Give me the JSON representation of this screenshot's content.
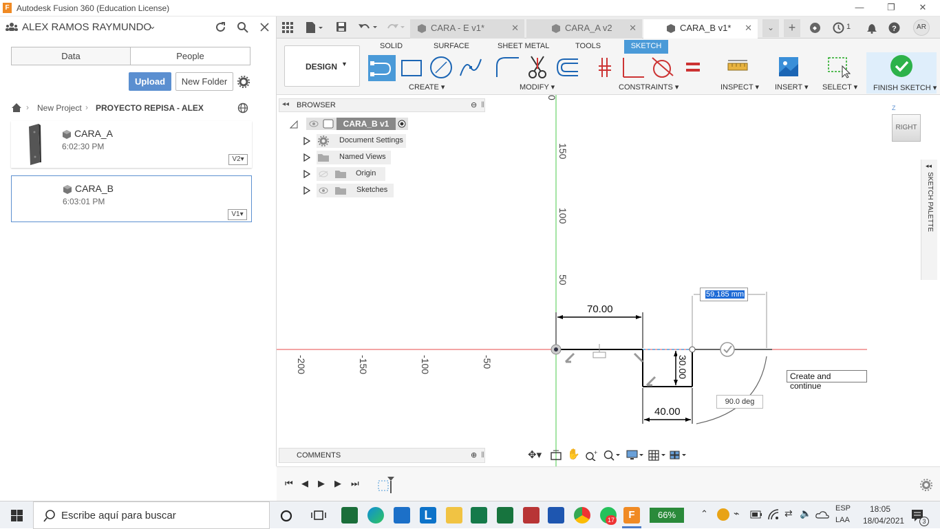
{
  "window": {
    "title": "Autodesk Fusion 360 (Education License)",
    "app_icon": "F"
  },
  "user": {
    "name": "ALEX RAMOS RAYMUNDO",
    "avatar": "AR"
  },
  "data_panel": {
    "tabs": [
      "Data",
      "People"
    ],
    "upload_label": "Upload",
    "new_folder_label": "New Folder",
    "breadcrumb": [
      "New Project",
      "PROYECTO REPISA - ALEX"
    ],
    "files": [
      {
        "name": "CARA_A",
        "time": "6:02:30 PM",
        "version": "V2"
      },
      {
        "name": "CARA_B",
        "time": "6:03:01 PM",
        "version": "V1"
      }
    ]
  },
  "doc_tabs": [
    {
      "label": "CARA - E v1*",
      "active": false
    },
    {
      "label": "CARA_A v2",
      "active": false
    },
    {
      "label": "CARA_B v1*",
      "active": true
    }
  ],
  "header_badges": {
    "jobs_count": "1"
  },
  "ribbon": {
    "workspace": "DESIGN",
    "tabs": [
      "SOLID",
      "SURFACE",
      "SHEET METAL",
      "TOOLS",
      "SKETCH"
    ],
    "active_tab": "SKETCH",
    "groups": [
      "CREATE",
      "MODIFY",
      "CONSTRAINTS",
      "INSPECT",
      "INSERT",
      "SELECT",
      "FINISH SKETCH"
    ]
  },
  "browser": {
    "title": "BROWSER",
    "root": "CARA_B v1",
    "items": [
      "Document Settings",
      "Named Views",
      "Origin",
      "Sketches"
    ]
  },
  "comments_label": "COMMENTS",
  "canvas": {
    "ticks_v": [
      "0",
      "150",
      "100",
      "50"
    ],
    "ticks_h": [
      "-200",
      "-150",
      "-100",
      "-50"
    ],
    "dim_70": "70.00",
    "dim_30": "30.00",
    "dim_40": "40.00",
    "input_value": "59.185 mm",
    "angle": "90.0 deg",
    "tooltip": "Create and continue"
  },
  "palette_label": "SKETCH PALETTE",
  "viewcube": {
    "face": "RIGHT",
    "axis": "Z"
  },
  "taskbar": {
    "search_placeholder": "Escribe aquí para buscar",
    "battery": "66%",
    "lang": "ESP",
    "lang2": "LAA",
    "time": "18:05",
    "date": "18/04/2021",
    "whatsapp_badge": "17",
    "notif_badge": "3"
  },
  "colors": {
    "accent": "#4a9ad8",
    "upload": "#5b8fd0",
    "finish": "#2db24a",
    "x_axis": "#e84a4a",
    "y_axis": "#4ac94a"
  }
}
